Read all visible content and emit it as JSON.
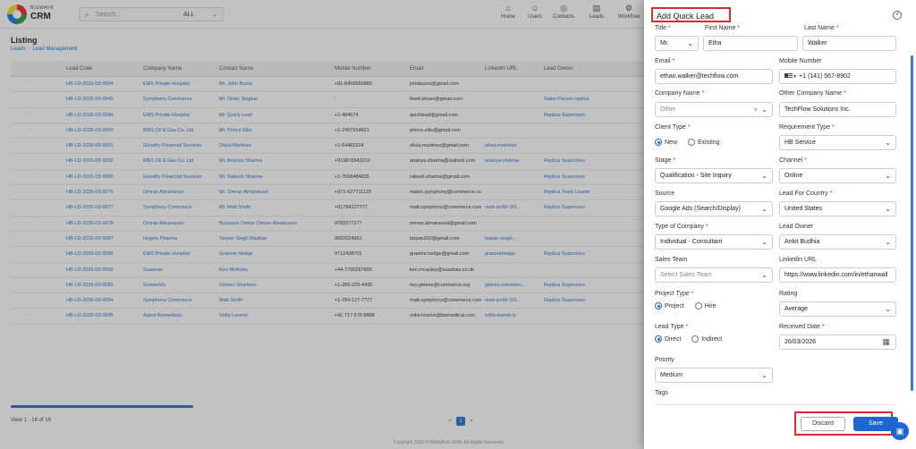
{
  "app": {
    "brand_top": "BIGWAVE",
    "brand_name": "CRM",
    "search_placeholder": "Search...",
    "search_scope": "ALL",
    "nav": [
      {
        "label": "Home",
        "icon": "home-icon"
      },
      {
        "label": "Users",
        "icon": "users-icon"
      },
      {
        "label": "Contacts",
        "icon": "contacts-icon"
      },
      {
        "label": "Leads",
        "icon": "leads-icon"
      },
      {
        "label": "Workflow",
        "icon": "workflow-icon"
      }
    ],
    "page_title": "Listing",
    "breadcrumb": [
      "Leads",
      "Lead Management"
    ],
    "table_headers": [
      "Lead Code",
      "Company Name",
      "Contact Name",
      "Mobile Number",
      "Email",
      "LinkedIn URL",
      "Lead Owner"
    ],
    "table_rows": [
      [
        "HB-LD-2026-03-0004",
        "EMS Private Hospital",
        "Mr. John Burns",
        "+91-8459566889",
        "johnburns@gmail.com",
        "",
        ""
      ],
      [
        "HB-LD-2026-03-0045",
        "Symphony Commerce",
        "Mr. Dinky Singhal",
        "-",
        "fixed.ahsan@gmail.com",
        "",
        "Sales Person replica"
      ],
      [
        "HB-LD-2026-03-0049",
        "EMS Private Hospital",
        "Mr. Quick Lead",
        "+1-484674",
        "quicklead@gmail.com",
        "",
        "Replica Supervisor"
      ],
      [
        "HB-LD-2026-03-0050",
        "MBS Oil & Gas Co. Ltd",
        "Mr. Prince Ellie",
        "+1-2497914621",
        "prince.ellie@gmail.com",
        "",
        ""
      ],
      [
        "HB-LD-2026-03-0051",
        "Goodfry Financial Services",
        "Olivia Martinez",
        "+1-64482924",
        "olivia.martinez@gmail.com",
        "olivia-martinez",
        ""
      ],
      [
        "HB-LD-2026-03-0052",
        "MBS Oil & Gas Co. Ltd",
        "Mr. Ananya Sharma",
        "+919876543210",
        "ananya.sharma@outlook.com",
        "ananya-sharma",
        "Replica Supervisor"
      ],
      [
        "HB-LD-2026-03-0055",
        "Goodfry Financial Services",
        "Mr. Rakesh Sharma",
        "+1-7698484825",
        "rakesh.sharma@gmail.com",
        "",
        "Replica Supervisor"
      ],
      [
        "HB-LD-2026-03-0076",
        "Omran Almansouri",
        "Mr. Omran Almansouri",
        "+971-527711129",
        "matrix.symphony@commerce.com",
        "",
        "Replica Team Leader"
      ],
      [
        "HB-LD-2026-03-0077",
        "Symphony Commerce",
        "Mr. Matt Smith",
        "+61784127777",
        "matt.symphony@commerce.com",
        "matt-smith-3f3...",
        "Replica Supervisor"
      ],
      [
        "HB-LD-2026-03-0078",
        "Omran Almansouri",
        "Business Owner Omran Almansouri",
        "9782277277",
        "omran.almansouri@gmail.com",
        "",
        ""
      ],
      [
        "HB-LD-2026-03-0087",
        "Hygeia Pharma",
        "Tarpan Singh Madhav",
        "9982624961",
        "tarpan202@gmail.com",
        "tarpan-singh-...",
        ""
      ],
      [
        "HB-LD-2026-03-0088",
        "EMS Private Hospital",
        "Graeme Hedge",
        "9712428701",
        "graeme.hedge@gmail.com",
        "graemehedge",
        "Replica Supervisor"
      ],
      [
        "HB-LD-2026-03-0092",
        "Suastras",
        "Ken McAuley",
        "+44-7700267890",
        "ken.mcauley@suastras.co.uk",
        "",
        ""
      ],
      [
        "HB-LD-2026-03-0093",
        "GeteesVis",
        "Getees Shantaro",
        "+1-289-225-4435",
        "hey.getees@commerce.org",
        "getees-commerc...",
        "Replica Supervisor"
      ],
      [
        "HB-LD-2026-03-0094",
        "Symphony Commerce",
        "Matt Smith",
        "+1-784-127-7777",
        "matt.symphony@commerce.com",
        "matt-smith-3f3...",
        "Replica Supervisor"
      ],
      [
        "HB-LD-2026-03-0095",
        "Agent Biomedical",
        "Sofia Lorenzi",
        "+41 717 678 8888",
        "sofia.lorenzi@biomedical.com",
        "sofia-lorenzi-b",
        ""
      ]
    ],
    "footer_view": "View 1 - 16 of 16",
    "pager": [
      "<",
      "1",
      ">"
    ],
    "copyright": "Copyright 2026 © BIGWAVE CRM. All Rights Reserved."
  },
  "drawer": {
    "title": "Add Quick Lead",
    "close_icon": "close-icon",
    "fields": {
      "title": {
        "label": "Title",
        "value": "Mr."
      },
      "first_name": {
        "label": "First Name",
        "value": "Etha"
      },
      "last_name": {
        "label": "Last Name",
        "value": "Walker"
      },
      "email": {
        "label": "Email",
        "value": "ethan.walker@techflow.com"
      },
      "mobile": {
        "label": "Mobile Number",
        "value": "+1 (141) 567-8902",
        "country_flag": "us-flag-icon"
      },
      "company_name": {
        "label": "Company Name",
        "placeholder": "Other"
      },
      "other_company": {
        "label": "Other Company Name",
        "value": "TechFlow Solutions Inc."
      },
      "client_type": {
        "label": "Client Type",
        "options": [
          "New",
          "Existing"
        ],
        "selected": "New"
      },
      "requirement_type": {
        "label": "Requirement Type",
        "value": "HB Service"
      },
      "stage": {
        "label": "Stage",
        "value": "Qualification - Site Inquiry"
      },
      "channel": {
        "label": "Channel",
        "value": "Online"
      },
      "source": {
        "label": "Source",
        "value": "Google Ads (Search/Display)"
      },
      "lead_country": {
        "label": "Lead For Country",
        "value": "United States"
      },
      "type_of_company": {
        "label": "Type of Company",
        "value": "Individual - Consultant"
      },
      "lead_owner": {
        "label": "Lead Owner",
        "value": "Ankit Budhia"
      },
      "sales_team": {
        "label": "Sales Team",
        "placeholder": "Select Sales Team"
      },
      "linkedin_url": {
        "label": "Linkedin URL",
        "value": "https://www.linkedin.com/in/ethanwall"
      },
      "project_type": {
        "label": "Project Type",
        "options": [
          "Project",
          "Hire"
        ],
        "selected": "Project"
      },
      "rating": {
        "label": "Rating",
        "value": "Average"
      },
      "lead_type": {
        "label": "Lead Type",
        "options": [
          "Direct",
          "Indirect"
        ],
        "selected": "Direct"
      },
      "received_date": {
        "label": "Received Date",
        "value": "26/03/2026"
      },
      "priority": {
        "label": "Priority",
        "value": "Medium"
      },
      "tags": {
        "label": "Tags"
      }
    },
    "buttons": {
      "discard": "Discard",
      "save": "Save"
    }
  },
  "colors": {
    "accent": "#1e66d0",
    "required": "#d32f2f",
    "highlight_box": "#d32f2f"
  }
}
